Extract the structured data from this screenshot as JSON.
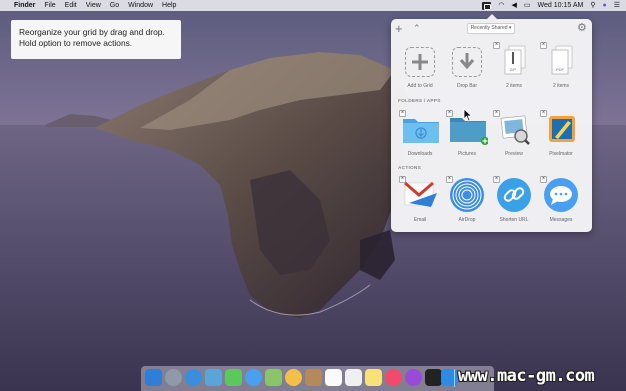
{
  "menubar": {
    "app_name": "Finder",
    "items": [
      "File",
      "Edit",
      "View",
      "Go",
      "Window",
      "Help"
    ],
    "clock": "Wed 10:15 AM"
  },
  "tip": {
    "line1": "Reorganize your grid by drag and drop.",
    "line2": "Hold option to remove actions."
  },
  "panel": {
    "filter_select": "Recently Shared ▾",
    "top_row": [
      {
        "caption": "Add to Grid",
        "icon": "plus-icon"
      },
      {
        "caption": "Drop Bar",
        "icon": "down-arrow-icon"
      },
      {
        "caption": "2 items",
        "icon": "zip-file-icon",
        "file_label": "ZIP"
      },
      {
        "caption": "2 items",
        "icon": "pdf-file-icon",
        "file_label": "PDF"
      }
    ],
    "folders_label": "FOLDERS / APPS",
    "folders": [
      {
        "caption": "Downloads",
        "icon": "downloads-folder-icon"
      },
      {
        "caption": "Pictures",
        "icon": "pictures-folder-icon"
      },
      {
        "caption": "Preview",
        "icon": "preview-app-icon"
      },
      {
        "caption": "Pixelmator",
        "icon": "pixelmator-app-icon"
      }
    ],
    "actions_label": "ACTIONS",
    "actions": [
      {
        "caption": "Email",
        "icon": "mail-icon"
      },
      {
        "caption": "AirDrop",
        "icon": "airdrop-icon"
      },
      {
        "caption": "Shorten URL",
        "icon": "link-icon"
      },
      {
        "caption": "Messages",
        "icon": "messages-icon"
      }
    ]
  },
  "watermark": "www.mac-gm.com",
  "colors": {
    "accent_blue": "#2f8ae5",
    "folder_blue": "#5bb3e8",
    "panel_bg": "#f4f4f6"
  }
}
